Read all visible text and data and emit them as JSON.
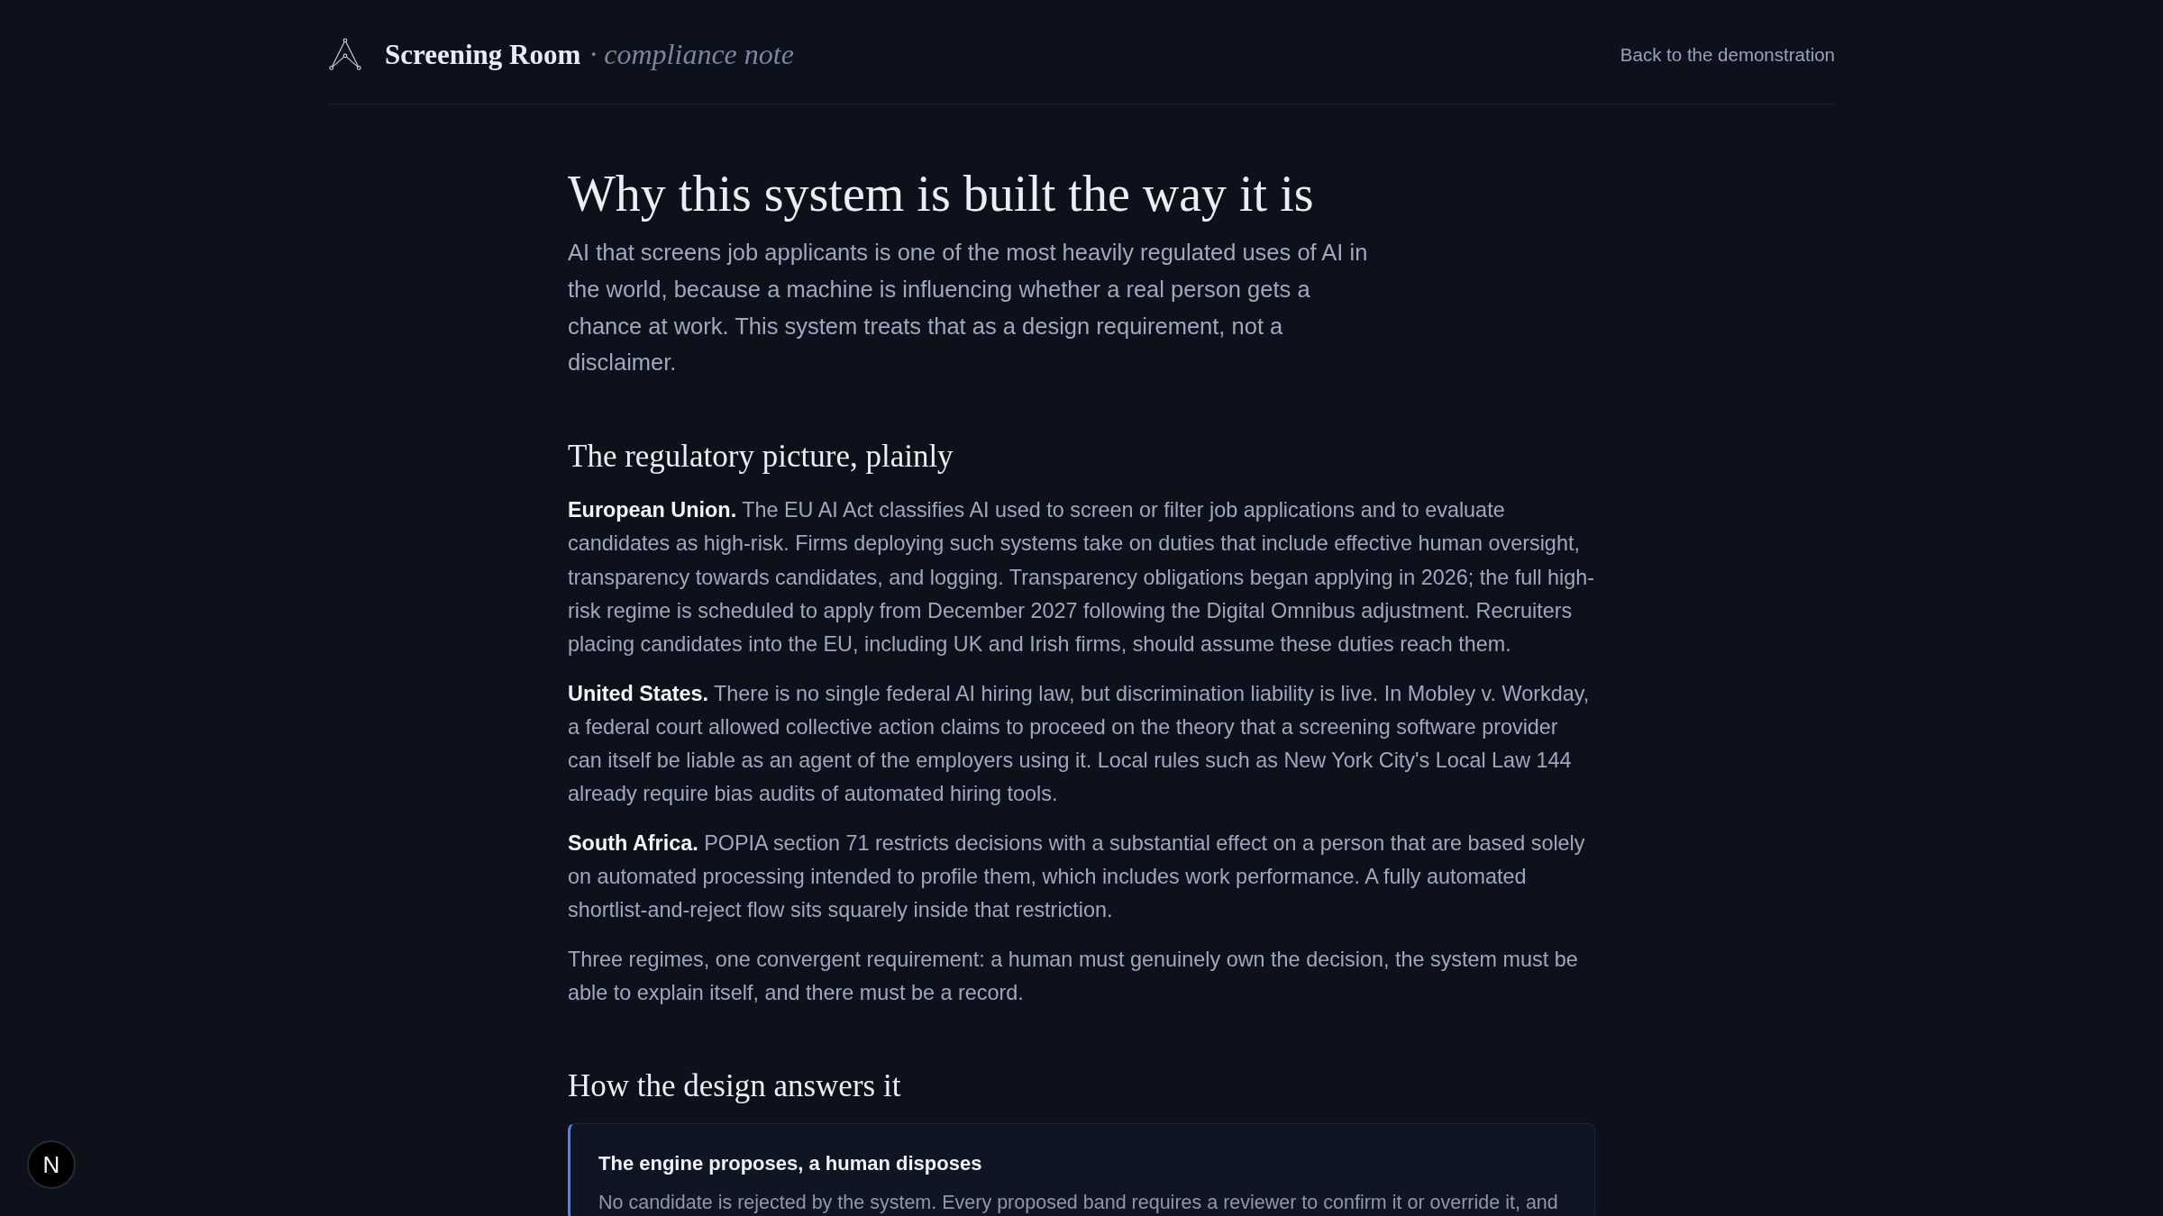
{
  "header": {
    "brand": "Screening Room",
    "subtitle": "· compliance note",
    "back_link": "Back to the demonstration"
  },
  "title": "Why this system is built the way it is",
  "intro": "AI that screens job applicants is one of the most heavily regulated uses of AI in the world, because a machine is influencing whether a real person gets a chance at work. This system treats that as a design requirement, not a disclaimer.",
  "sections": [
    {
      "heading": "The regulatory picture, plainly",
      "paragraphs": [
        "**European Union.** The EU AI Act classifies AI used to screen or filter job applications and to evaluate candidates as high-risk. Firms deploying such systems take on duties that include effective human oversight, transparency towards candidates, and logging. Transparency obligations began applying in 2026; the full high-risk regime is scheduled to apply from December 2027 following the Digital Omnibus adjustment. Recruiters placing candidates into the EU, including UK and Irish firms, should assume these duties reach them.",
        "**United States.** There is no single federal AI hiring law, but discrimination liability is live. In Mobley v. Workday, a federal court allowed collective action claims to proceed on the theory that a screening software provider can itself be liable as an agent of the employers using it. Local rules such as New York City's Local Law 144 already require bias audits of automated hiring tools.",
        "**South Africa.** POPIA section 71 restricts decisions with a substantial effect on a person that are based solely on automated processing intended to profile them, which includes work performance. A fully automated shortlist-and-reject flow sits squarely inside that restriction.",
        "Three regimes, one convergent requirement: a human must genuinely own the decision, the system must be able to explain itself, and there must be a record."
      ]
    },
    {
      "heading": "How the design answers it",
      "cards": [
        {
          "title": "The engine proposes, a human disposes",
          "text": "No candidate is rejected by the system. Every proposed band requires a reviewer to confirm it or override it, and"
        }
      ]
    }
  ],
  "dev_badge": {
    "label": "N"
  }
}
